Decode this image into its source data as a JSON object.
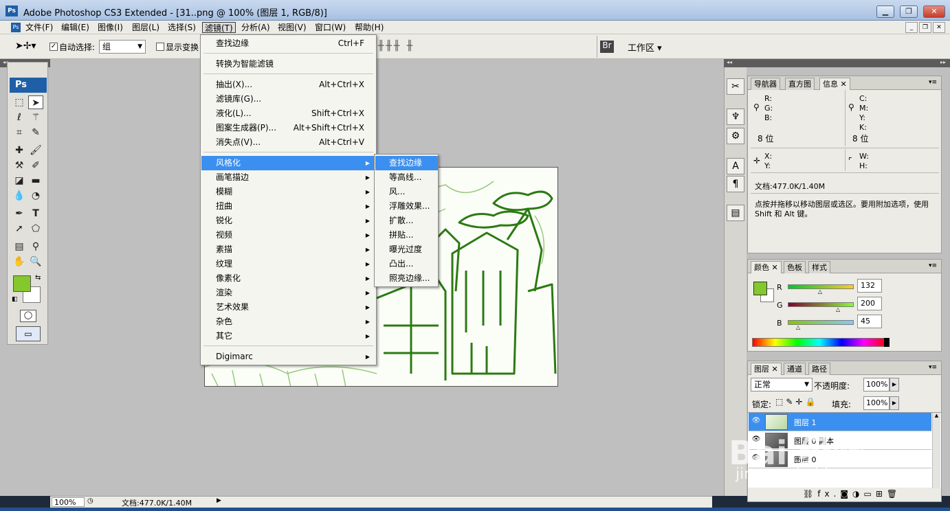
{
  "window": {
    "title": "Adobe Photoshop CS3 Extended - [31..png @ 100% (图层 1, RGB/8)]",
    "icon": "Ps",
    "minimize_glyph": "▁",
    "maximize_glyph": "❐",
    "close_glyph": "✕"
  },
  "menubar": {
    "app_icon": "Ps",
    "items": [
      "文件(F)",
      "编辑(E)",
      "图像(I)",
      "图层(L)",
      "选择(S)",
      "滤镜(T)",
      "分析(A)",
      "视图(V)",
      "窗口(W)",
      "帮助(H)"
    ],
    "doc_min": "_",
    "doc_restore": "❐",
    "doc_close": "✕"
  },
  "options_bar": {
    "tool_icon": "move-tool-icon",
    "auto_select_label": "自动选择:",
    "auto_select_checked": true,
    "auto_select_value": "组",
    "show_transform_label": "显示变换",
    "workspace_label": "工作区"
  },
  "filter_menu": {
    "items": [
      {
        "label": "查找边缘",
        "shortcut": "Ctrl+F"
      },
      {
        "label": "转换为智能滤镜",
        "shortcut": ""
      },
      {
        "label": "抽出(X)...",
        "shortcut": "Alt+Ctrl+X"
      },
      {
        "label": "滤镜库(G)...",
        "shortcut": ""
      },
      {
        "label": "液化(L)...",
        "shortcut": "Shift+Ctrl+X"
      },
      {
        "label": "图案生成器(P)...",
        "shortcut": "Alt+Shift+Ctrl+X"
      },
      {
        "label": "消失点(V)...",
        "shortcut": "Alt+Ctrl+V"
      },
      {
        "label": "风格化",
        "shortcut": ""
      },
      {
        "label": "画笔描边",
        "shortcut": ""
      },
      {
        "label": "模糊",
        "shortcut": ""
      },
      {
        "label": "扭曲",
        "shortcut": ""
      },
      {
        "label": "锐化",
        "shortcut": ""
      },
      {
        "label": "视频",
        "shortcut": ""
      },
      {
        "label": "素描",
        "shortcut": ""
      },
      {
        "label": "纹理",
        "shortcut": ""
      },
      {
        "label": "像素化",
        "shortcut": ""
      },
      {
        "label": "渲染",
        "shortcut": ""
      },
      {
        "label": "艺术效果",
        "shortcut": ""
      },
      {
        "label": "杂色",
        "shortcut": ""
      },
      {
        "label": "其它",
        "shortcut": ""
      },
      {
        "label": "Digimarc",
        "shortcut": ""
      }
    ],
    "highlighted": "风格化",
    "arrow_glyph": "▶"
  },
  "stylize_submenu": {
    "items": [
      "查找边缘",
      "等高线...",
      "风...",
      "浮雕效果...",
      "扩散...",
      "拼贴...",
      "曝光过度",
      "凸出...",
      "照亮边缘..."
    ],
    "highlighted": "查找边缘"
  },
  "toolbox": {
    "badge": "Ps",
    "foreground_color": "#84c82d",
    "background_color": "#ffffff"
  },
  "info_panel": {
    "tabs": [
      "导航器",
      "直方图",
      "信息"
    ],
    "active_tab": "信息",
    "rgb_labels": [
      "R:",
      "G:",
      "B:"
    ],
    "cmyk_labels": [
      "C:",
      "M:",
      "Y:",
      "K:"
    ],
    "bit_depth_left": "8 位",
    "bit_depth_right": "8 位",
    "xy_labels": [
      "X:",
      "Y:"
    ],
    "wh_labels": [
      "W:",
      "H:"
    ],
    "doc_size": "文档:477.0K/1.40M",
    "hint": "点按并拖移以移动图层或选区。要用附加选项，使用 Shift 和 Alt 键。"
  },
  "color_panel": {
    "tabs": [
      "颜色",
      "色板",
      "样式"
    ],
    "active_tab": "颜色",
    "channels": [
      {
        "label": "R",
        "value": "132"
      },
      {
        "label": "G",
        "value": "200"
      },
      {
        "label": "B",
        "value": "45"
      }
    ],
    "fg": "#84c82d"
  },
  "layers_panel": {
    "tabs": [
      "图层",
      "通道",
      "路径"
    ],
    "active_tab": "图层",
    "blend_mode": "正常",
    "opacity_label": "不透明度:",
    "opacity_value": "100%",
    "lock_label": "锁定:",
    "fill_label": "填充:",
    "fill_value": "100%",
    "layers": [
      {
        "name": "图层 1",
        "selected": true
      },
      {
        "name": "图层 0 副本",
        "selected": false
      },
      {
        "name": "图层 0",
        "selected": false
      }
    ],
    "footer_fx": "fx."
  },
  "status_bar": {
    "zoom": "100%",
    "doc_info": "文档:477.0K/1.40M"
  },
  "watermark": {
    "logo": "Bai 经验",
    "url": "jingyan.baidu.com"
  }
}
